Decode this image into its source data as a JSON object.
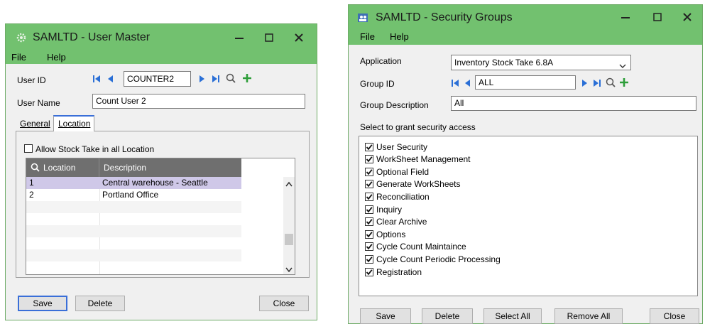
{
  "user_master": {
    "title": "SAMLTD - User Master",
    "menu": [
      "File",
      "Help"
    ],
    "user_id_label": "User ID",
    "user_id_value": "COUNTER2",
    "user_name_label": "User Name",
    "user_name_value": "Count User 2",
    "tabs": [
      "General",
      "Location"
    ],
    "active_tab": "Location",
    "allow_all_label": "Allow Stock Take in all Location",
    "allow_all_checked": false,
    "grid": {
      "columns": [
        "Location",
        "Description"
      ],
      "rows": [
        {
          "location": "1",
          "description": "Central warehouse - Seattle"
        },
        {
          "location": "2",
          "description": "Portland Office"
        }
      ]
    },
    "buttons": {
      "save": "Save",
      "delete": "Delete",
      "close": "Close"
    }
  },
  "security_groups": {
    "title": "SAMLTD - Security Groups",
    "menu": [
      "File",
      "Help"
    ],
    "application_label": "Application",
    "application_value": "Inventory Stock Take 6.8A",
    "group_id_label": "Group ID",
    "group_id_value": "ALL",
    "group_desc_label": "Group Description",
    "group_desc_value": "All",
    "grant_label": "Select to grant security access",
    "permissions": [
      {
        "label": "User Security",
        "checked": true
      },
      {
        "label": "WorkSheet Management",
        "checked": true
      },
      {
        "label": "Optional Field",
        "checked": true
      },
      {
        "label": "Generate WorkSheets",
        "checked": true
      },
      {
        "label": "Reconciliation",
        "checked": true
      },
      {
        "label": "Inquiry",
        "checked": true
      },
      {
        "label": "Clear Archive",
        "checked": true
      },
      {
        "label": "Options",
        "checked": true
      },
      {
        "label": "Cycle Count Maintaince",
        "checked": true
      },
      {
        "label": "Cycle Count Periodic Processing",
        "checked": true
      },
      {
        "label": "Registration",
        "checked": true
      }
    ],
    "buttons": {
      "save": "Save",
      "delete": "Delete",
      "select_all": "Select All",
      "remove_all": "Remove All",
      "close": "Close"
    }
  },
  "colors": {
    "titlebar": "#72c16f",
    "accent_green": "#2e9e3a",
    "nav_blue": "#2a6fd6",
    "grid_header": "#6f6f6f",
    "row_selected": "#cfc8e8"
  }
}
